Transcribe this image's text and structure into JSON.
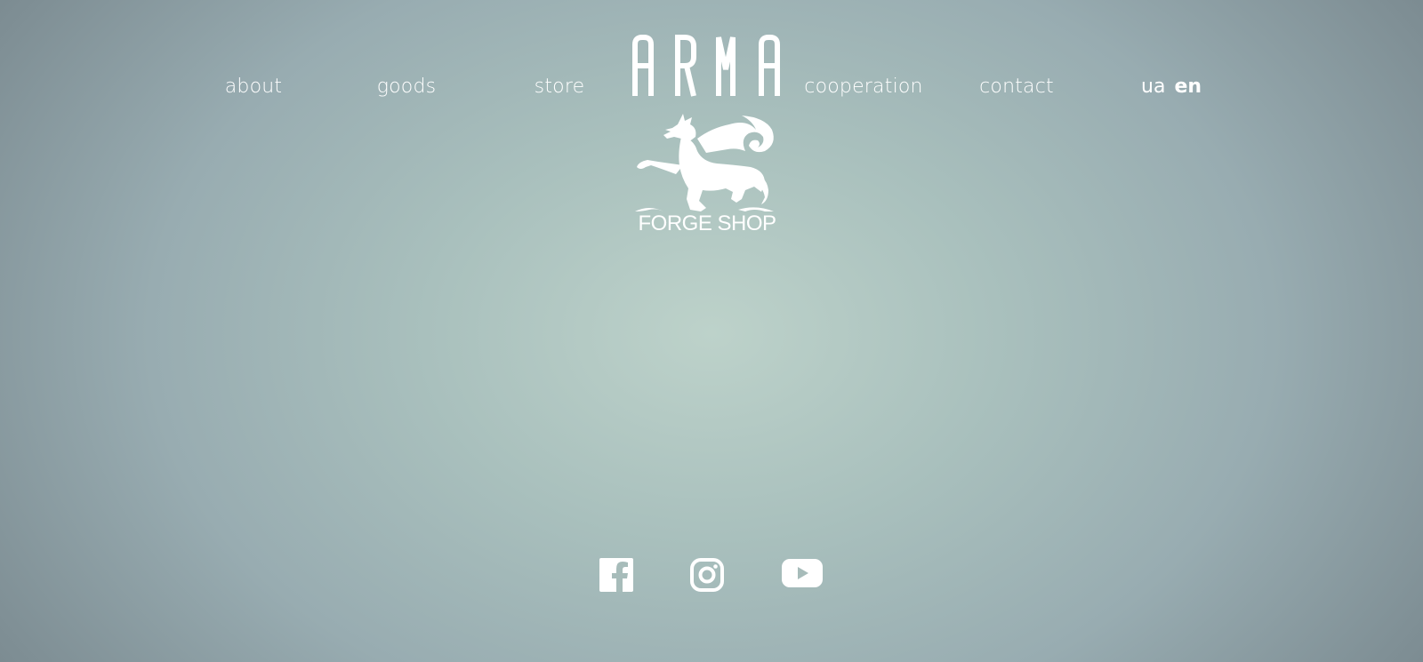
{
  "nav": {
    "items": [
      {
        "id": "about",
        "label": "about"
      },
      {
        "id": "goods",
        "label": "goods"
      },
      {
        "id": "store",
        "label": "store"
      },
      {
        "id": "cooperation",
        "label": "cooperation"
      },
      {
        "id": "contact",
        "label": "contact"
      }
    ]
  },
  "lang": {
    "ua": "ua",
    "en": "en",
    "active": "en"
  },
  "logo": {
    "brand": "ARMA",
    "subtitle": "FORGE SHOP",
    "emblem": "griffin-emblem"
  },
  "social": {
    "icons": [
      "facebook-icon",
      "instagram-icon",
      "youtube-icon"
    ]
  },
  "colors": {
    "text": "#ffffff",
    "background_center": "#bdd2ca",
    "background_edge": "#6c7a80"
  }
}
